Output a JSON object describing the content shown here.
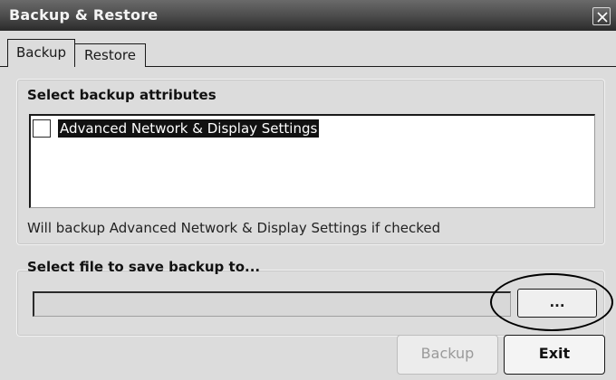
{
  "window": {
    "title": "Backup & Restore",
    "close_icon": "close-icon"
  },
  "tabs": [
    {
      "label": "Backup",
      "selected": true
    },
    {
      "label": "Restore",
      "selected": false
    }
  ],
  "attributes": {
    "title": "Select backup attributes",
    "items": [
      {
        "label": "Advanced Network & Display Settings",
        "checked": false,
        "highlighted": true
      }
    ],
    "hint": "Will backup Advanced Network & Display Settings if checked"
  },
  "file": {
    "title": "Select file to save backup to...",
    "path_value": "",
    "browse_label": "..."
  },
  "actions": {
    "backup_label": "Backup",
    "backup_enabled": false,
    "exit_label": "Exit"
  }
}
